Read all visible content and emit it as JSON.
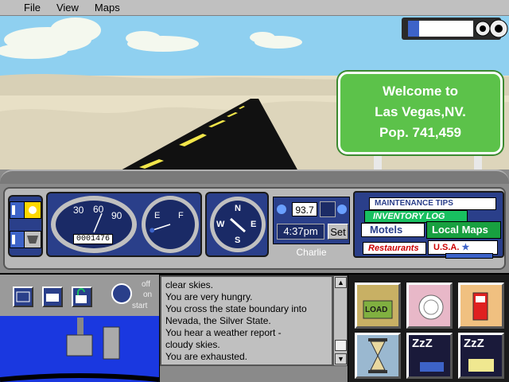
{
  "menu": {
    "file": "File",
    "view": "View",
    "maps": "Maps"
  },
  "sign": {
    "line1": "Welcome to",
    "line2": "Las Vegas,NV.",
    "line3": "Pop. 741,459"
  },
  "gauges": {
    "speed_ticks": [
      "30",
      "60",
      "90"
    ],
    "odometer": "0001476",
    "fuel_empty": "E",
    "fuel_full": "F",
    "fuel_level": 0.1,
    "compass": {
      "n": "N",
      "s": "S",
      "e": "E",
      "w": "W"
    }
  },
  "radio": {
    "frequency": "93.7"
  },
  "clock": {
    "time": "4:37pm",
    "set_label": "Set"
  },
  "driver": "Charlie",
  "books": {
    "maintenance": "MAINTENANCE TIPS",
    "inventory": "INVENTORY LOG",
    "motels": "Motels",
    "local_maps": "Local Maps",
    "restaurants": "Restaurants",
    "usa": "U.S.A."
  },
  "switch": {
    "off": "off",
    "on": "on",
    "start": "start"
  },
  "log": {
    "lines": [
      "clear skies.",
      "You are very hungry.",
      "You cross the state boundary into",
      "Nevada, the Silver State.",
      "You hear a weather report -",
      "cloudy skies.",
      "You are exhausted."
    ]
  },
  "actions": {
    "load_label": "LOAD",
    "sleep_label": "ZzZ"
  },
  "colors": {
    "sky": "#8fd0f0",
    "sign_green": "#5cc24a",
    "panel_blue": "#2a3f8a",
    "pedal_blue": "#1a38e0"
  }
}
